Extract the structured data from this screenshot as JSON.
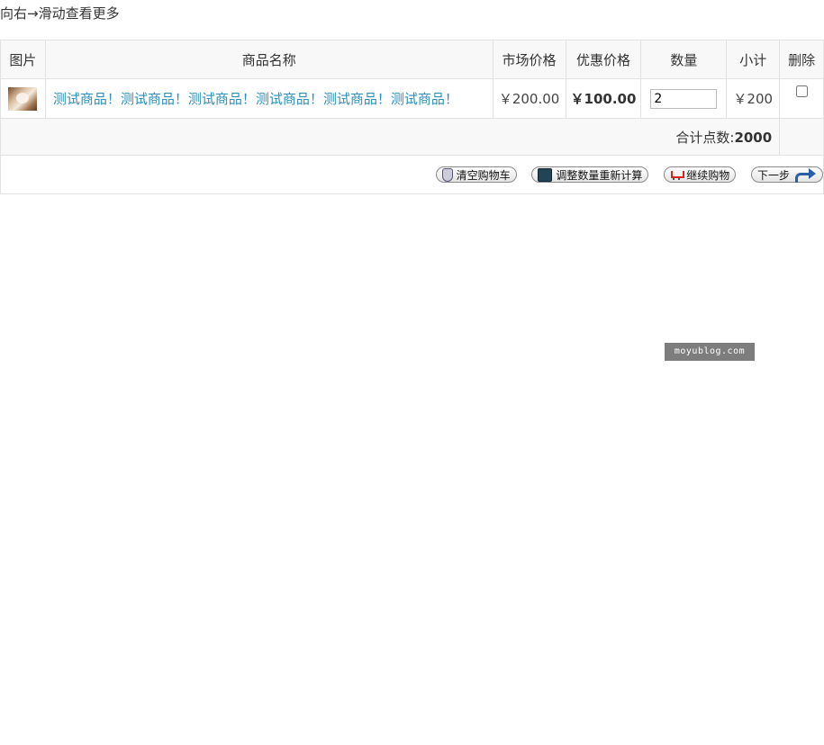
{
  "hint": "向右→滑动查看更多",
  "headers": {
    "image": "图片",
    "name": "商品名称",
    "market_price": "市场价格",
    "promo_price": "优惠价格",
    "quantity": "数量",
    "subtotal": "小计",
    "delete": "删除"
  },
  "items": [
    {
      "image_icon": "product-thumbnail",
      "name": "测试商品！测试商品！测试商品！测试商品！测试商品！测试商品！",
      "market_price": "￥200.00",
      "promo_price": "￥100.00",
      "quantity": "2",
      "subtotal": "￥200",
      "delete_checked": false
    }
  ],
  "total": {
    "label": "合计点数:",
    "value": "2000"
  },
  "buttons": {
    "clear_cart": "清空购物车",
    "recalculate": "调整数量重新计算",
    "continue_shopping": "继续购物",
    "next_step": "下一步"
  },
  "watermark": "moyublog.com"
}
